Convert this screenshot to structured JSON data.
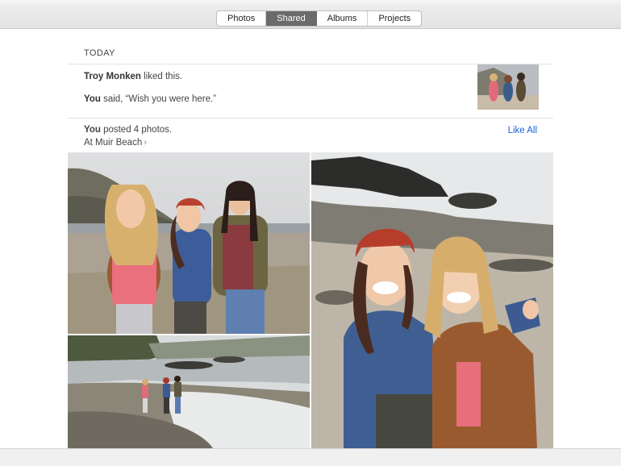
{
  "tabs": [
    {
      "label": "Photos",
      "active": false
    },
    {
      "label": "Shared",
      "active": true
    },
    {
      "label": "Albums",
      "active": false
    },
    {
      "label": "Projects",
      "active": false
    }
  ],
  "feed": {
    "day_header": "TODAY",
    "like": {
      "user": "Troy Monken",
      "text": " liked this."
    },
    "comment": {
      "user": "You",
      "text": " said, “Wish you were here.”"
    },
    "post": {
      "user": "You",
      "text": " posted 4 photos.",
      "location": "At Muir Beach"
    },
    "like_all_label": "Like All"
  },
  "colors": {
    "accent": "#1a5fd6",
    "active_tab": "#6b6b6b"
  }
}
